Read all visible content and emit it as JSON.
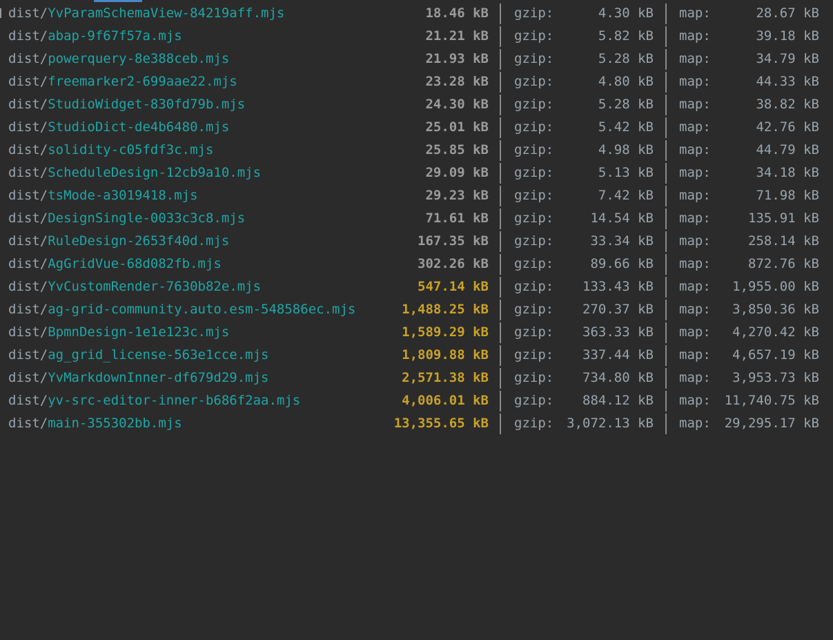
{
  "output": {
    "dir_prefix": "dist/",
    "gzip_label": "gzip:",
    "map_label": "map:",
    "rows": [
      {
        "file": "YvParamSchemaView-84219aff.mjs",
        "size": "18.46 kB",
        "gzip": "4.30 kB",
        "map": "28.67 kB",
        "warn": false
      },
      {
        "file": "abap-9f67f57a.mjs",
        "size": "21.21 kB",
        "gzip": "5.82 kB",
        "map": "39.18 kB",
        "warn": false
      },
      {
        "file": "powerquery-8e388ceb.mjs",
        "size": "21.93 kB",
        "gzip": "5.28 kB",
        "map": "34.79 kB",
        "warn": false
      },
      {
        "file": "freemarker2-699aae22.mjs",
        "size": "23.28 kB",
        "gzip": "4.80 kB",
        "map": "44.33 kB",
        "warn": false
      },
      {
        "file": "StudioWidget-830fd79b.mjs",
        "size": "24.30 kB",
        "gzip": "5.28 kB",
        "map": "38.82 kB",
        "warn": false
      },
      {
        "file": "StudioDict-de4b6480.mjs",
        "size": "25.01 kB",
        "gzip": "5.42 kB",
        "map": "42.76 kB",
        "warn": false
      },
      {
        "file": "solidity-c05fdf3c.mjs",
        "size": "25.85 kB",
        "gzip": "4.98 kB",
        "map": "44.79 kB",
        "warn": false
      },
      {
        "file": "ScheduleDesign-12cb9a10.mjs",
        "size": "29.09 kB",
        "gzip": "5.13 kB",
        "map": "34.18 kB",
        "warn": false
      },
      {
        "file": "tsMode-a3019418.mjs",
        "size": "29.23 kB",
        "gzip": "7.42 kB",
        "map": "71.98 kB",
        "warn": false
      },
      {
        "file": "DesignSingle-0033c3c8.mjs",
        "size": "71.61 kB",
        "gzip": "14.54 kB",
        "map": "135.91 kB",
        "warn": false
      },
      {
        "file": "RuleDesign-2653f40d.mjs",
        "size": "167.35 kB",
        "gzip": "33.34 kB",
        "map": "258.14 kB",
        "warn": false
      },
      {
        "file": "AgGridVue-68d082fb.mjs",
        "size": "302.26 kB",
        "gzip": "89.66 kB",
        "map": "872.76 kB",
        "warn": false
      },
      {
        "file": "YvCustomRender-7630b82e.mjs",
        "size": "547.14 kB",
        "gzip": "133.43 kB",
        "map": "1,955.00 kB",
        "warn": true
      },
      {
        "file": "ag-grid-community.auto.esm-548586ec.mjs",
        "size": "1,488.25 kB",
        "gzip": "270.37 kB",
        "map": "3,850.36 kB",
        "warn": true
      },
      {
        "file": "BpmnDesign-1e1e123c.mjs",
        "size": "1,589.29 kB",
        "gzip": "363.33 kB",
        "map": "4,270.42 kB",
        "warn": true
      },
      {
        "file": "ag_grid_license-563e1cce.mjs",
        "size": "1,809.88 kB",
        "gzip": "337.44 kB",
        "map": "4,657.19 kB",
        "warn": true
      },
      {
        "file": "YvMarkdownInner-df679d29.mjs",
        "size": "2,571.38 kB",
        "gzip": "734.80 kB",
        "map": "3,953.73 kB",
        "warn": true
      },
      {
        "file": "yv-src-editor-inner-b686f2aa.mjs",
        "size": "4,006.01 kB",
        "gzip": "884.12 kB",
        "map": "11,740.75 kB",
        "warn": true
      },
      {
        "file": "main-355302bb.mjs",
        "size": "13,355.65 kB",
        "gzip": "3,072.13 kB",
        "map": "29,295.17 kB",
        "warn": true
      }
    ]
  }
}
